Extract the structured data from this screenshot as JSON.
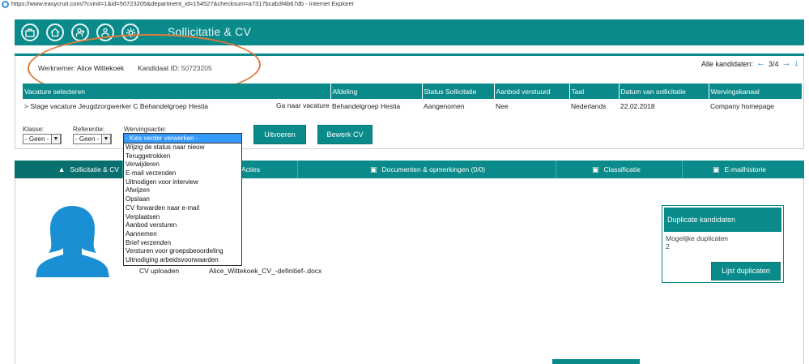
{
  "window": {
    "title": "https://www.easycruit.com/?cvinit=1&id=50723205&department_id=154527&checksum=a7317bcab3f4b67db - Internet Explorer"
  },
  "app": {
    "title": "Sollicitatie & CV",
    "nav_icons": [
      "bag-icon",
      "home-icon",
      "add-person-icon",
      "people-icon",
      "settings-icon"
    ]
  },
  "candidate": {
    "employee_label": "Werknemer:",
    "employee_name": "Alice Wittekoek",
    "candidate_id_label": "Kandidaat ID:",
    "candidate_id": "50723205"
  },
  "pager": {
    "label": "Alle kandidaten:",
    "position": "3/4"
  },
  "table": {
    "headers": [
      "Vacature selecteren",
      "Afdeling",
      "Status Sollicitatie",
      "Aanbod verstuurd",
      "Taal",
      "Datum van sollicitatie",
      "Wervingskanaal"
    ],
    "row": {
      "vacancy": "> Stage vacature Jeugdzorgwerker C Behandelgroep Hestia",
      "go_link": "Ga naar vacature",
      "department": "Behandelgroep Hestia",
      "status": "Aangenomen",
      "offer_sent": "Nee",
      "language": "Nederlands",
      "date": "22.02.2018",
      "channel": "Company homepage"
    }
  },
  "filters": {
    "klasse_label": "Klasse:",
    "klasse_value": "- Geen -",
    "referentie_label": "Referentie:",
    "referentie_value": "- Geen -",
    "wervingsactie_label": "Wervingsactie:",
    "wervingsactie_value": "- Kies verder verwerken -",
    "execute_button": "Uitvoeren",
    "edit_cv_button": "Bewerk CV"
  },
  "action_options": [
    "Wijzig de status naar nieuw",
    "Teruggetrokken",
    "Verwijderen",
    "E-mail verzenden",
    "Uitnodigen voor interview",
    "Afwijzen",
    "Opslaan",
    "CV forwarden naar e-mail",
    "Verplaatsen",
    "Aanbod versturen",
    "Aannemen",
    "Brief verzenden",
    "Versturen voor groepsbeoordeling",
    "Uitnodiging arbeidsvoorwaarden"
  ],
  "tabs": [
    "Sollicitatie & CV",
    "Acties",
    "Documenten & opmerkingen (0/0)",
    "Classificatie",
    "E-mailhistorie"
  ],
  "cv": {
    "label": "CV uploaden",
    "filename": "Alice_Wittekoek_CV_-definitief-.docx"
  },
  "duplicates": {
    "title": "Duplicate kandidaten",
    "label": "Mogelijke duplicaten",
    "count": "2",
    "button": "Lijst duplicaten"
  },
  "colors": {
    "teal": "#0a8a8a",
    "highlight_ellipse": "#e07a3c",
    "selected_option": "#3399ff"
  }
}
